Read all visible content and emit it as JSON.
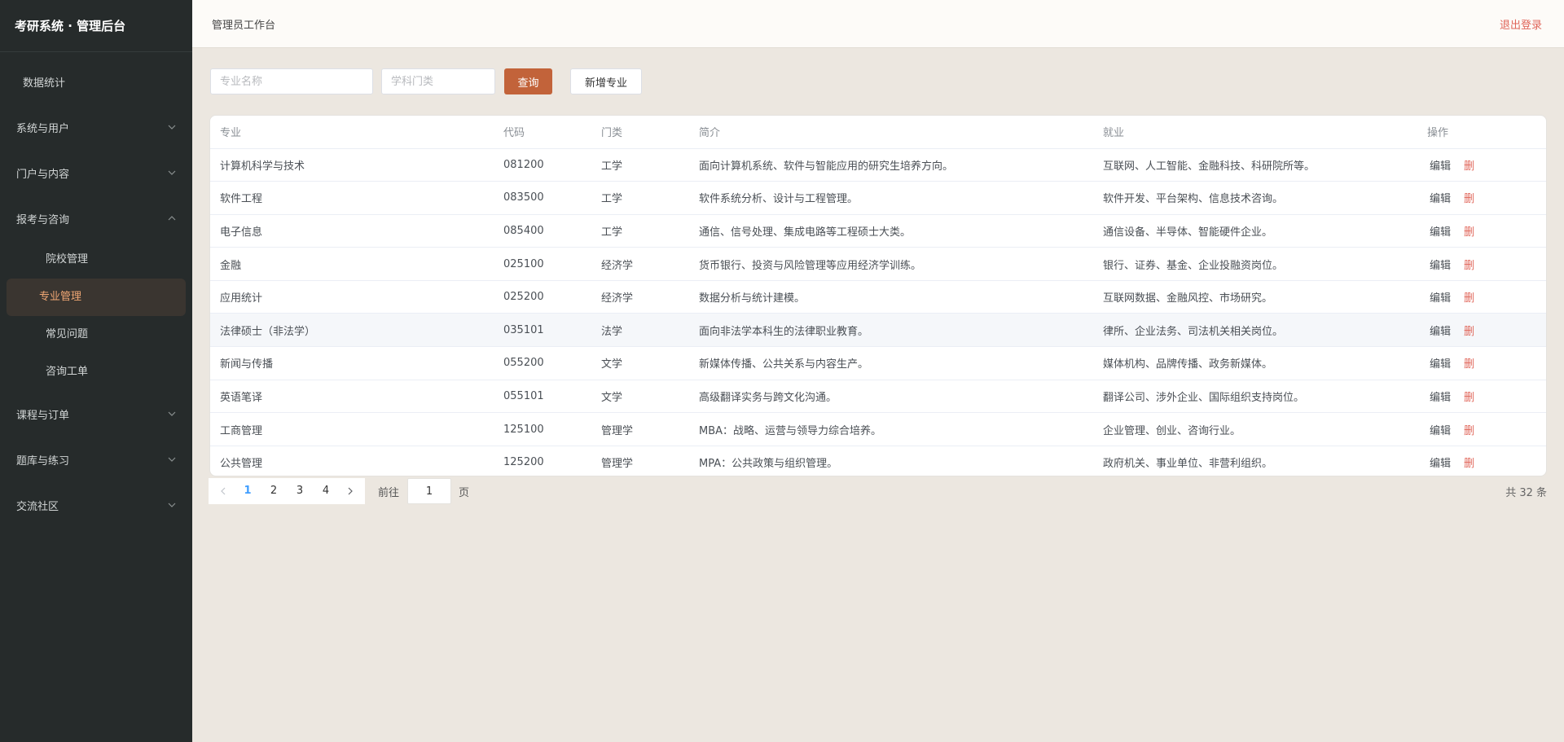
{
  "brand": "考研系统 · 管理后台",
  "sidebar": {
    "top_item": "数据统计",
    "groups": [
      {
        "label": "系统与用户",
        "expanded": false
      },
      {
        "label": "门户与内容",
        "expanded": false
      },
      {
        "label": "报考与咨询",
        "expanded": true
      },
      {
        "label": "课程与订单",
        "expanded": false
      },
      {
        "label": "题库与练习",
        "expanded": false
      },
      {
        "label": "交流社区",
        "expanded": false
      }
    ],
    "sub_items": [
      "院校管理",
      "专业管理",
      "常见问题",
      "咨询工单"
    ],
    "active_sub": "专业管理"
  },
  "header": {
    "title": "管理员工作台",
    "logout": "退出登录"
  },
  "filters": {
    "major_placeholder": "专业名称",
    "category_placeholder": "学科门类",
    "query_label": "查询",
    "add_label": "新增专业"
  },
  "table": {
    "columns": [
      "专业",
      "代码",
      "门类",
      "简介",
      "就业",
      "操作"
    ],
    "edit_label": "编辑",
    "delete_label": "删",
    "rows": [
      {
        "name": "计算机科学与技术",
        "code": "081200",
        "category": "工学",
        "intro": "面向计算机系统、软件与智能应用的研究生培养方向。",
        "career": "互联网、人工智能、金融科技、科研院所等。"
      },
      {
        "name": "软件工程",
        "code": "083500",
        "category": "工学",
        "intro": "软件系统分析、设计与工程管理。",
        "career": "软件开发、平台架构、信息技术咨询。"
      },
      {
        "name": "电子信息",
        "code": "085400",
        "category": "工学",
        "intro": "通信、信号处理、集成电路等工程硕士大类。",
        "career": "通信设备、半导体、智能硬件企业。"
      },
      {
        "name": "金融",
        "code": "025100",
        "category": "经济学",
        "intro": "货币银行、投资与风险管理等应用经济学训练。",
        "career": "银行、证券、基金、企业投融资岗位。"
      },
      {
        "name": "应用统计",
        "code": "025200",
        "category": "经济学",
        "intro": "数据分析与统计建模。",
        "career": "互联网数据、金融风控、市场研究。"
      },
      {
        "name": "法律硕士（非法学）",
        "code": "035101",
        "category": "法学",
        "intro": "面向非法学本科生的法律职业教育。",
        "career": "律所、企业法务、司法机关相关岗位。"
      },
      {
        "name": "新闻与传播",
        "code": "055200",
        "category": "文学",
        "intro": "新媒体传播、公共关系与内容生产。",
        "career": "媒体机构、品牌传播、政务新媒体。"
      },
      {
        "name": "英语笔译",
        "code": "055101",
        "category": "文学",
        "intro": "高级翻译实务与跨文化沟通。",
        "career": "翻译公司、涉外企业、国际组织支持岗位。"
      },
      {
        "name": "工商管理",
        "code": "125100",
        "category": "管理学",
        "intro": "MBA：战略、运营与领导力综合培养。",
        "career": "企业管理、创业、咨询行业。"
      },
      {
        "name": "公共管理",
        "code": "125200",
        "category": "管理学",
        "intro": "MPA：公共政策与组织管理。",
        "career": "政府机关、事业单位、非营利组织。"
      }
    ]
  },
  "pagination": {
    "pages": [
      "1",
      "2",
      "3",
      "4"
    ],
    "current": "1",
    "goto_prefix": "前往",
    "goto_value": "1",
    "goto_suffix": "页",
    "total": "共 32 条"
  },
  "colors": {
    "sidebar_bg": "#262b2b",
    "accent": "#c2633a",
    "active_text": "#f0a774",
    "danger": "#e0665a",
    "page_active": "#409eff"
  }
}
